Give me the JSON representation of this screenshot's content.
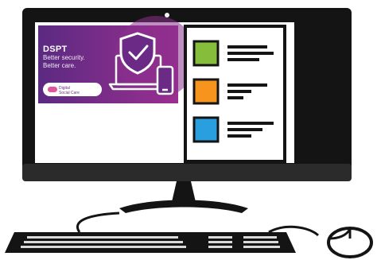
{
  "banner": {
    "title": "DSPT",
    "line1": "Better security.",
    "line2": "Better care.",
    "badge_line1": "Digital",
    "badge_line2": "Social Care"
  },
  "checklist": {
    "items": [
      {
        "color": "#86bd3a"
      },
      {
        "color": "#f7941d"
      },
      {
        "color": "#2a9fe0"
      }
    ]
  },
  "colors": {
    "frame": "#141414",
    "banner_left": "#5b2a82",
    "banner_right": "#9b2f8f",
    "badge_pink": "#e0569a"
  },
  "icons": [
    "shield-check-icon",
    "laptop-icon",
    "phone-icon",
    "keyboard-icon",
    "mouse-icon",
    "webcam-icon"
  ]
}
